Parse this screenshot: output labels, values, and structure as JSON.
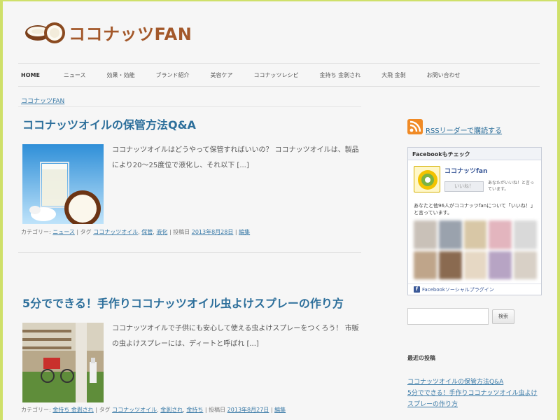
{
  "site": {
    "logo_text": "ココナッツFAN"
  },
  "nav": {
    "items": [
      "HOME",
      "ニュース",
      "効果・効能",
      "ブランド紹介",
      "美容ケア",
      "ココナッツレシピ",
      "金持ち 金剝され",
      "大飛 金剝",
      "お問い合わせ"
    ]
  },
  "breadcrumb": "ココナッツFAN",
  "posts": [
    {
      "title": "ココナッツオイルの保管方法Q&A",
      "excerpt": "ココナッツオイルはどうやって保管すればいいの？ ココナッツオイルは、製品により20〜25度位で液化し、それ以下 [...]",
      "meta": {
        "category_label": "カテゴリー:",
        "category": "ニュース",
        "tag_label": "| タグ",
        "tags": [
          "ココナッツオイル",
          "保管",
          "液化"
        ],
        "date_label": "| 投稿日",
        "date": "2013年8月28日",
        "edit": "編集"
      }
    },
    {
      "title": "5分でできる！手作りココナッツオイル虫よけスプレーの作り方",
      "excerpt": "ココナッツオイルで子供にも安心して使える虫よけスプレーをつくろう！ 市販の虫よけスプレーには、ディートと呼ばれ [...]",
      "meta": {
        "category_label": "カテゴリー:",
        "category": "金持ち 金剝され",
        "tag_label": "| タグ",
        "tags": [
          "ココナッツオイル",
          "金剝され",
          "金持ち"
        ],
        "date_label": "| 投稿日",
        "date": "2013年8月27日",
        "edit": "編集"
      }
    }
  ],
  "sidebar": {
    "rss_text": "RSSリーダーで購読する",
    "facebook": {
      "header": "Facebookもチェック",
      "page_name": "ココナッツfan",
      "like_button": "いいね！",
      "like_note": "あなたがいいね！と言っています。",
      "description": "あなたと他96人がココナッツfanについて「いいね！」と言っています。",
      "footer": "Facebookソーシャルプラグイン"
    },
    "search_button": "検索",
    "recent_title": "最近の投稿",
    "recent_posts": [
      "ココナッツオイルの保管方法Q&A",
      "5分でできる！手作りココナッツオイル虫よけ",
      "スプレーの作り方"
    ]
  },
  "colors": {
    "accent": "#2d6f9b",
    "logo": "#a3582a",
    "border": "#cfe06a",
    "rss": "#f08a25",
    "facebook": "#3b5998"
  }
}
